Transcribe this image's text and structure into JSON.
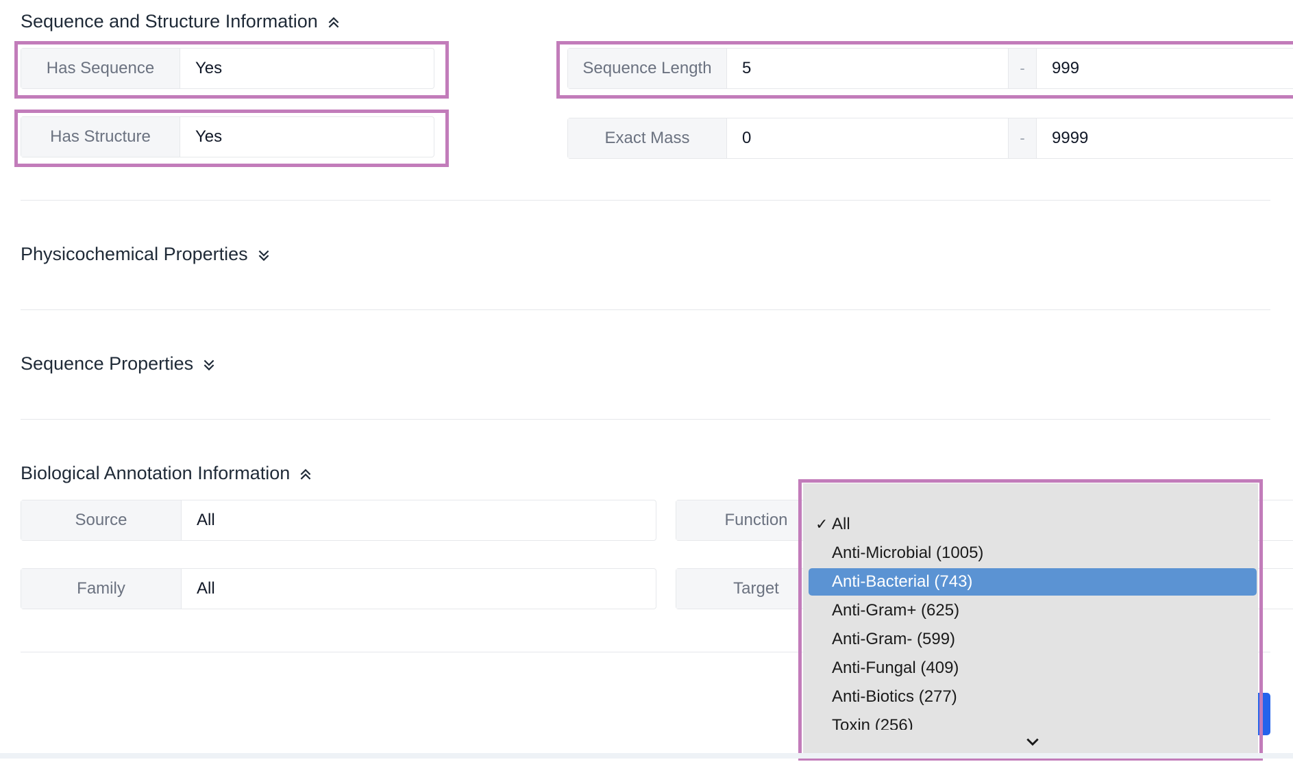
{
  "sequence_structure": {
    "title": "Sequence and Structure Information",
    "has_sequence": {
      "label": "Has Sequence",
      "value": "Yes"
    },
    "has_structure": {
      "label": "Has Structure",
      "value": "Yes"
    },
    "sequence_length": {
      "label": "Sequence Length",
      "min": "5",
      "separator": "-",
      "max": "999"
    },
    "exact_mass": {
      "label": "Exact Mass",
      "min": "0",
      "separator": "-",
      "max": "9999"
    }
  },
  "physicochemical": {
    "title": "Physicochemical Properties"
  },
  "sequence_properties": {
    "title": "Sequence Properties"
  },
  "biological": {
    "title": "Biological Annotation Information",
    "source": {
      "label": "Source",
      "value": "All"
    },
    "family": {
      "label": "Family",
      "value": "All"
    },
    "function": {
      "label": "Function"
    },
    "target": {
      "label": "Target"
    }
  },
  "function_dropdown": {
    "options": [
      {
        "label": "All",
        "checked": true
      },
      {
        "label": "Anti-Microbial (1005)"
      },
      {
        "label": "Anti-Bacterial (743)",
        "highlighted": true
      },
      {
        "label": "Anti-Gram+ (625)"
      },
      {
        "label": "Anti-Gram- (599)"
      },
      {
        "label": "Anti-Fungal (409)"
      },
      {
        "label": "Anti-Biotics (277)"
      },
      {
        "label": "Toxin (256)"
      }
    ],
    "check_mark": "✓",
    "highlight_color": "#5b93d3"
  },
  "colors": {
    "annotation_border": "#c27cba",
    "accent": "#2563eb"
  }
}
